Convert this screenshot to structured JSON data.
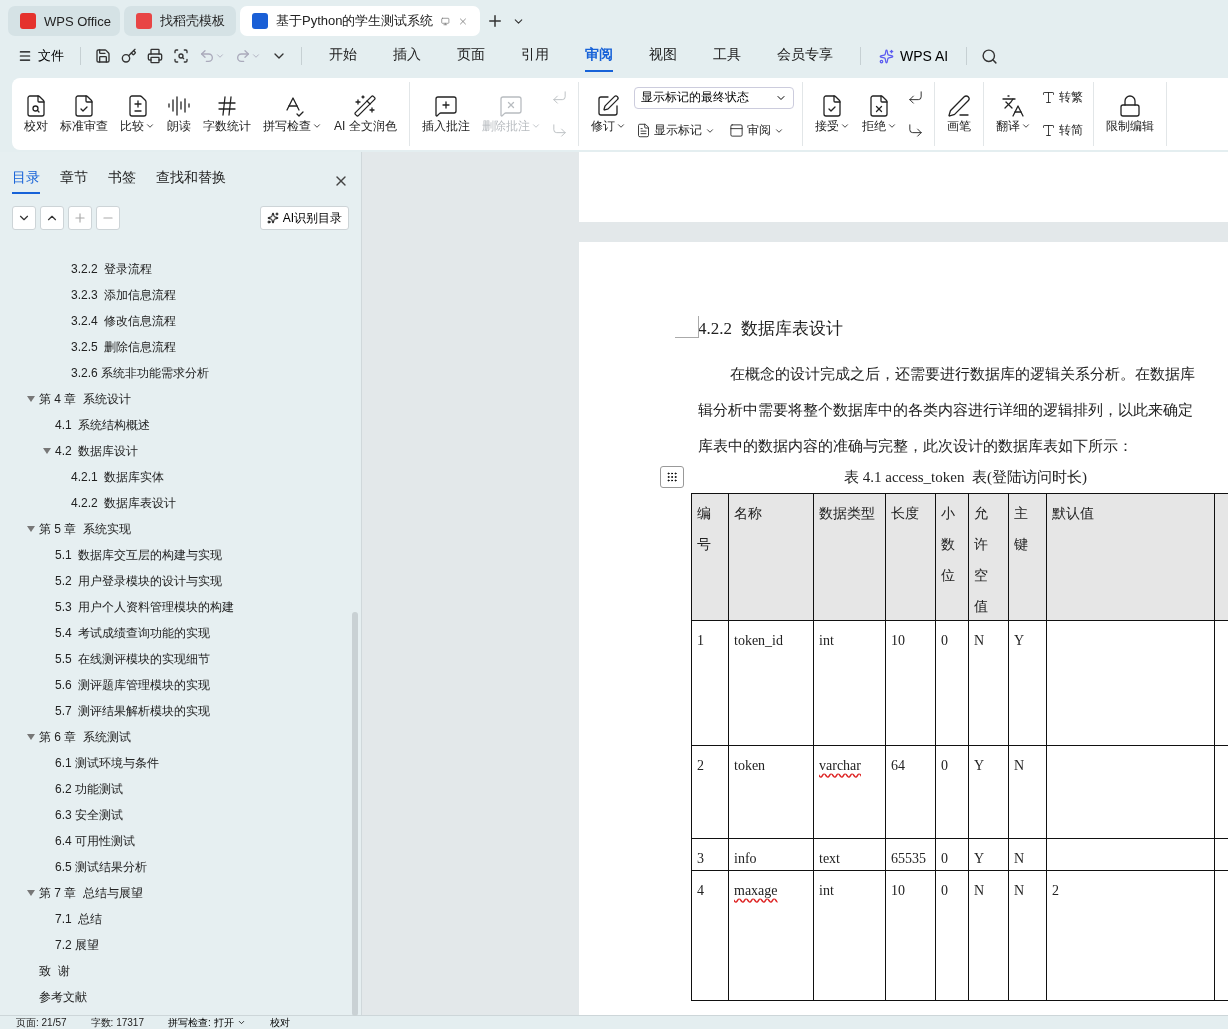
{
  "title_tabs": [
    {
      "kind": "home",
      "label": "WPS Office",
      "selected": false
    },
    {
      "kind": "template",
      "label": "找稻壳模板",
      "selected": false
    },
    {
      "kind": "doc",
      "label": "基于Python的学生测试系统",
      "selected": true
    }
  ],
  "menu": {
    "file_label": "文件",
    "tabs": [
      {
        "label": "开始",
        "selected": false
      },
      {
        "label": "插入",
        "selected": false
      },
      {
        "label": "页面",
        "selected": false
      },
      {
        "label": "引用",
        "selected": false
      },
      {
        "label": "审阅",
        "selected": true
      },
      {
        "label": "视图",
        "selected": false
      },
      {
        "label": "工具",
        "selected": false
      },
      {
        "label": "会员专享",
        "selected": false
      }
    ],
    "ai_label": "WPS AI"
  },
  "ribbon": {
    "groups": [
      {
        "columns": [
          [
            [
              {
                "kind": "large",
                "label": "校对",
                "dropdown": false,
                "disabled": false
              }
            ]
          ],
          [
            [
              {
                "kind": "large",
                "label": "标准审查",
                "dropdown": false,
                "disabled": false
              }
            ]
          ],
          [
            [
              {
                "kind": "large",
                "label": "比较",
                "dropdown": true,
                "disabled": false
              }
            ]
          ],
          [
            [
              {
                "kind": "large",
                "label": "朗读",
                "dropdown": false,
                "disabled": false
              }
            ]
          ],
          [
            [
              {
                "kind": "large",
                "label": "字数统计",
                "dropdown": false,
                "disabled": false
              }
            ]
          ],
          [
            [
              {
                "kind": "large",
                "label": "拼写检查",
                "dropdown": true,
                "disabled": false
              }
            ]
          ],
          [
            [
              {
                "kind": "large",
                "label": "AI 全文润色",
                "dropdown": false,
                "disabled": false
              }
            ]
          ]
        ]
      },
      {
        "columns": [
          [
            [
              {
                "kind": "large",
                "label": "插入批注",
                "dropdown": false,
                "disabled": false
              }
            ]
          ],
          [
            [
              {
                "kind": "large",
                "label": "删除批注",
                "dropdown": true,
                "disabled": true
              }
            ]
          ],
          [
            [
              {
                "kind": "icon",
                "disabled": true
              }
            ],
            [
              {
                "kind": "icon",
                "disabled": true
              }
            ]
          ]
        ]
      },
      {
        "columns": [
          [
            [
              {
                "kind": "large",
                "label": "修订",
                "dropdown": true,
                "disabled": false
              }
            ]
          ],
          [
            [
              {
                "kind": "select",
                "value": "显示标记的最终状态"
              }
            ],
            [
              {
                "kind": "small",
                "label": "显示标记",
                "dropdown": true,
                "disabled": false
              },
              {
                "kind": "small",
                "label": "审阅",
                "dropdown": true,
                "disabled": false
              }
            ]
          ]
        ]
      },
      {
        "columns": [
          [
            [
              {
                "kind": "large",
                "label": "接受",
                "dropdown": true,
                "disabled": false
              }
            ]
          ],
          [
            [
              {
                "kind": "large",
                "label": "拒绝",
                "dropdown": true,
                "disabled": false
              }
            ]
          ],
          [
            [
              {
                "kind": "icon",
                "disabled": false
              }
            ],
            [
              {
                "kind": "icon",
                "disabled": false
              }
            ]
          ]
        ]
      },
      {
        "columns": [
          [
            [
              {
                "kind": "large",
                "label": "画笔",
                "dropdown": false,
                "disabled": false
              }
            ]
          ]
        ]
      },
      {
        "columns": [
          [
            [
              {
                "kind": "large",
                "label": "翻译",
                "dropdown": true,
                "disabled": false
              }
            ]
          ],
          [
            [
              {
                "kind": "small",
                "label": "转繁",
                "dropdown": false,
                "disabled": false
              }
            ],
            [
              {
                "kind": "small",
                "label": "转简",
                "dropdown": false,
                "disabled": false
              }
            ]
          ]
        ]
      },
      {
        "columns": [
          [
            [
              {
                "kind": "large",
                "label": "限制编辑",
                "dropdown": false,
                "disabled": false
              }
            ]
          ]
        ]
      }
    ]
  },
  "sidebar": {
    "tabs": [
      {
        "label": "目录",
        "selected": true
      },
      {
        "label": "章节",
        "selected": false
      },
      {
        "label": "书签",
        "selected": false
      },
      {
        "label": "查找和替换",
        "selected": false
      }
    ],
    "ai_button": "AI识别目录",
    "toc": [
      {
        "children": [
          {
            "children": [
              {
                "label": "3.2.2  登录流程"
              },
              {
                "label": "3.2.3  添加信息流程"
              },
              {
                "label": "3.2.4  修改信息流程"
              },
              {
                "label": "3.2.5  删除信息流程"
              },
              {
                "label": "3.2.6 系统非功能需求分析"
              }
            ]
          }
        ]
      },
      {
        "label": "第 4 章  系统设计",
        "expanded": true,
        "children": [
          {
            "label": "4.1  系统结构概述"
          },
          {
            "label": "4.2  数据库设计",
            "expanded": true,
            "children": [
              {
                "label": "4.2.1  数据库实体"
              },
              {
                "label": "4.2.2  数据库表设计"
              }
            ]
          }
        ]
      },
      {
        "label": "第 5 章  系统实现",
        "expanded": true,
        "children": [
          {
            "label": "5.1  数据库交互层的构建与实现"
          },
          {
            "label": "5.2  用户登录模块的设计与实现"
          },
          {
            "label": "5.3  用户个人资料管理模块的构建"
          },
          {
            "label": "5.4  考试成绩查询功能的实现"
          },
          {
            "label": "5.5  在线测评模块的实现细节"
          },
          {
            "label": "5.6  测评题库管理模块的实现"
          },
          {
            "label": "5.7  测评结果解析模块的实现"
          }
        ]
      },
      {
        "label": "第 6 章  系统测试",
        "expanded": true,
        "children": [
          {
            "label": "6.1 测试环境与条件"
          },
          {
            "label": "6.2 功能测试"
          },
          {
            "label": "6.3 安全测试"
          },
          {
            "label": "6.4 可用性测试"
          },
          {
            "label": "6.5 测试结果分析"
          }
        ]
      },
      {
        "label": "第 7 章  总结与展望",
        "expanded": true,
        "children": [
          {
            "label": "7.1  总结"
          },
          {
            "label": "7.2 展望"
          }
        ]
      },
      {
        "label": "致  谢"
      },
      {
        "label": "参考文献"
      }
    ]
  },
  "document": {
    "heading": "4.2.2  数据库表设计",
    "paragraph_lines": [
      "在概念的设计完成之后，还需要进行数据库的逻辑关系分析。在数据库",
      "辑分析中需要将整个数据库中的各类内容进行详细的逻辑排列，以此来确定",
      "库表中的数据内容的准确与完整，此次设计的数据库表如下所示："
    ],
    "table_caption": "表 4.1 access_token  表(登陆访问时长)",
    "table": {
      "columns": [
        "编号",
        "名称",
        "数据类型",
        "长度",
        "小数位",
        "允许空值",
        "主键",
        "默认值"
      ],
      "rows": [
        [
          {
            "text": "1",
            "misspelled": false
          },
          {
            "text": "token_id",
            "misspelled": false
          },
          {
            "text": "int",
            "misspelled": false
          },
          {
            "text": "10",
            "misspelled": false
          },
          {
            "text": "0",
            "misspelled": false
          },
          {
            "text": "N",
            "misspelled": false
          },
          {
            "text": "Y",
            "misspelled": false
          },
          {}
        ],
        [
          {
            "text": "2",
            "misspelled": false
          },
          {
            "text": "token",
            "misspelled": false
          },
          {
            "text": "varchar",
            "misspelled": true
          },
          {
            "text": "64",
            "misspelled": false
          },
          {
            "text": "0",
            "misspelled": false
          },
          {
            "text": "Y",
            "misspelled": false
          },
          {
            "text": "N",
            "misspelled": false
          },
          {}
        ],
        [
          {
            "text": "3",
            "misspelled": false
          },
          {
            "text": "info",
            "misspelled": false
          },
          {
            "text": "text",
            "misspelled": false
          },
          {
            "text": "65535",
            "misspelled": false
          },
          {
            "text": "0",
            "misspelled": false
          },
          {
            "text": "Y",
            "misspelled": false
          },
          {
            "text": "N",
            "misspelled": false
          },
          {}
        ],
        [
          {
            "text": "4",
            "misspelled": false
          },
          {
            "text": "maxage",
            "misspelled": true
          },
          {
            "text": "int",
            "misspelled": false
          },
          {
            "text": "10",
            "misspelled": false
          },
          {
            "text": "0",
            "misspelled": false
          },
          {
            "text": "N",
            "misspelled": false
          },
          {
            "text": "N",
            "misspelled": false
          },
          {
            "text": "2",
            "misspelled": false
          }
        ]
      ]
    }
  },
  "status_bar": {
    "page": "页面: 21/57",
    "words": "字数: 17317",
    "spell_check": "拼写检查: 打开",
    "proofread": "校对"
  }
}
